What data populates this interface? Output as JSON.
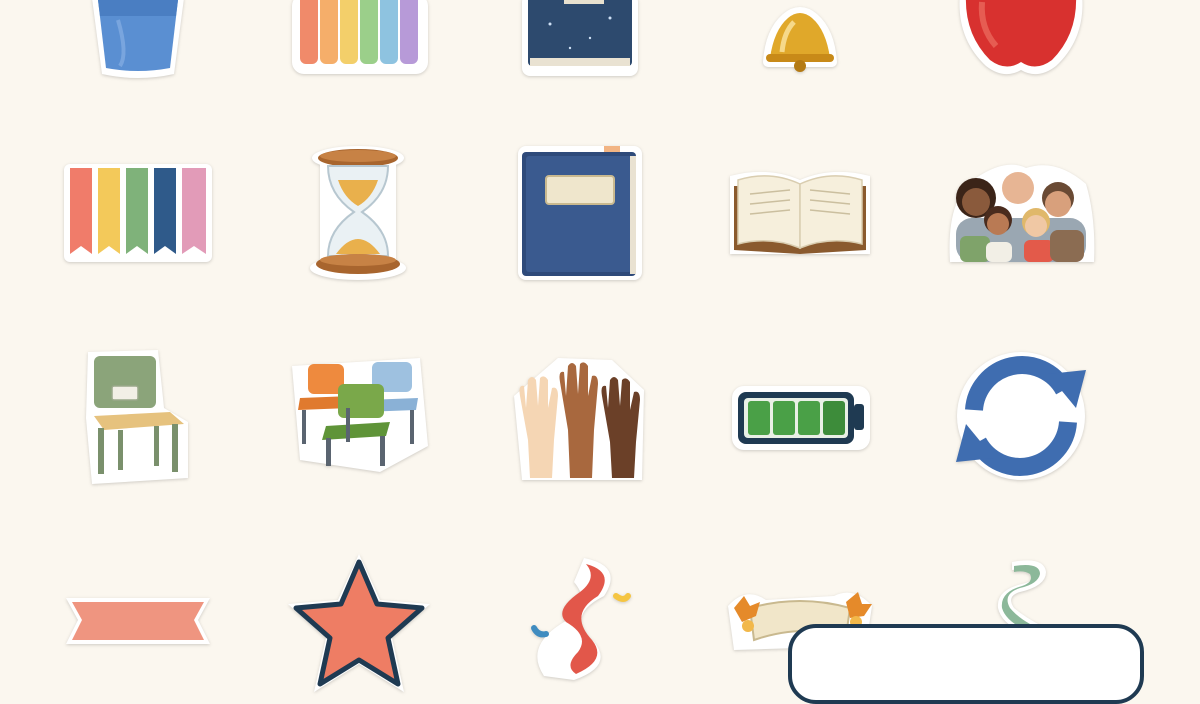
{
  "page": {
    "background": "#fbf7ef"
  },
  "stickers": [
    {
      "name": "pencil-cup-icon"
    },
    {
      "name": "colored-pencils-icon"
    },
    {
      "name": "starry-notebook-icon"
    },
    {
      "name": "school-bell-icon"
    },
    {
      "name": "red-apple-icon"
    },
    {
      "name": "rainbow-bookmarks-icon"
    },
    {
      "name": "hourglass-icon"
    },
    {
      "name": "blue-book-icon"
    },
    {
      "name": "open-book-icon"
    },
    {
      "name": "family-group-icon"
    },
    {
      "name": "school-chair-icon"
    },
    {
      "name": "classroom-chairs-icon"
    },
    {
      "name": "raised-hands-icon"
    },
    {
      "name": "full-battery-icon"
    },
    {
      "name": "refresh-arrows-icon"
    },
    {
      "name": "pink-ribbon-banner-icon"
    },
    {
      "name": "coral-star-icon"
    },
    {
      "name": "swirl-ribbon-icon"
    },
    {
      "name": "autumn-leaves-banner-icon"
    },
    {
      "name": "green-swirl-ribbon-icon"
    }
  ],
  "colors": {
    "panel_border": "#1f3a52",
    "apple_red": "#d8312f",
    "navy_book": "#2e4a7a",
    "battery_green": "#4aa047",
    "refresh_blue": "#3f6db0",
    "star_coral": "#ee7d64"
  }
}
